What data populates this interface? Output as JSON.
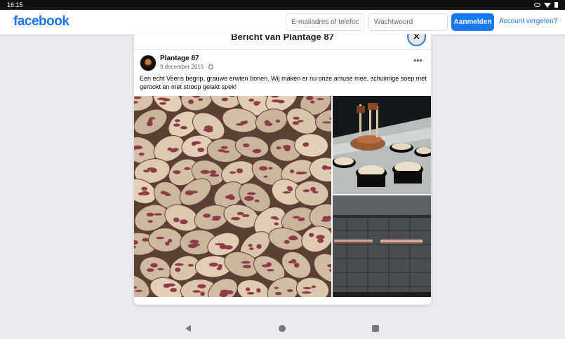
{
  "status_bar": {
    "time": "16:15"
  },
  "header": {
    "logo": "facebook",
    "email_placeholder": "E-mailadres of telefoonn",
    "password_placeholder": "Wachtwoord",
    "login_label": "Aanmelden",
    "forgot_label": "Account vergeten?"
  },
  "modal": {
    "title": "Bericht van Plantage 87",
    "close_glyph": "✕"
  },
  "post": {
    "page_name": "Plantage 87",
    "date": "9 december 2015 ·",
    "more_glyph": "•••",
    "text": "Een echt Veens begrip, grauwe erwten bonen. Wij maken er nu onze amuse mee, schuimige soep met gerookt en met stroop gelakt spek!",
    "photos": [
      {
        "icon": "beans-photo"
      },
      {
        "icon": "amuse-bowls-photo"
      },
      {
        "icon": "smoked-bacon-photo"
      }
    ]
  },
  "colors": {
    "brand": "#1877f2",
    "background": "#e9ebee"
  }
}
